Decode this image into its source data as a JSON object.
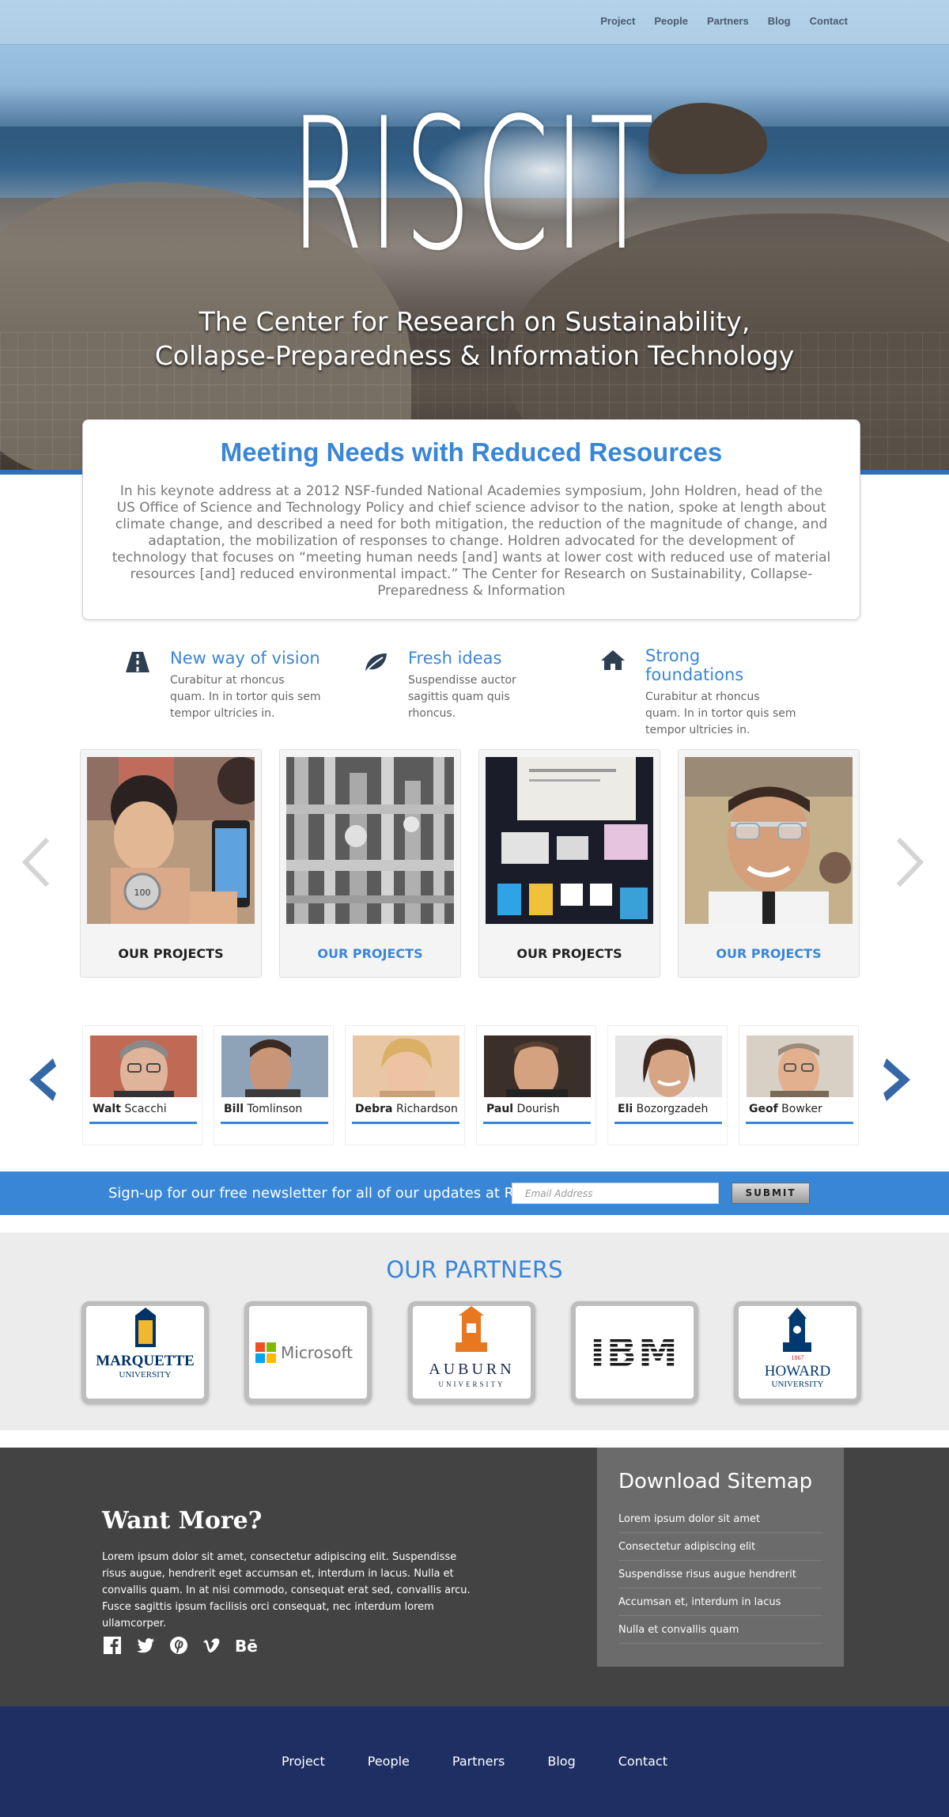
{
  "nav": {
    "items": [
      "Project",
      "People",
      "Partners",
      "Blog",
      "Contact"
    ]
  },
  "hero": {
    "logo": "RISCIT",
    "tagline_line1": "The Center for Research on Sustainability,",
    "tagline_line2": "Collapse-Preparedness & Information Technology"
  },
  "intro": {
    "title": "Meeting Needs with Reduced Resources",
    "body": "In his keynote address at a 2012 NSF-funded National Academies symposium, John Holdren, head of the US Office of Science and Technology Policy and chief science advisor to the nation, spoke at length about climate change, and described a need for both mitigation, the reduction of the magnitude of change, and adaptation, the mobilization of responses to change. Holdren advocated for the development of technology that focuses on “meeting human needs [and] wants at lower cost with reduced use of material resources [and] reduced environmental impact.” The Center for Research on Sustainability, Collapse-Preparedness & Information"
  },
  "features": [
    {
      "icon": "road-icon",
      "title": "New way of vision",
      "text": "Curabitur at rhoncus quam. In in tortor quis sem tempor ultricies in."
    },
    {
      "icon": "leaf-icon",
      "title": "Fresh ideas",
      "text": "Suspendisse auctor sagittis quam quis rhoncus."
    },
    {
      "icon": "home-icon",
      "title": "Strong foundations",
      "text": "Curabitur at rhoncus quam. In in tortor quis sem tempor ultricies in."
    }
  ],
  "projects": [
    {
      "caption": "OUR PROJECTS",
      "style": "dark"
    },
    {
      "caption": "OUR PROJECTS",
      "style": "blue"
    },
    {
      "caption": "OUR PROJECTS",
      "style": "dark"
    },
    {
      "caption": "OUR PROJECTS",
      "style": "blue"
    }
  ],
  "people": [
    {
      "first": "Walt",
      "last": " Scacchi"
    },
    {
      "first": "Bill",
      "last": " Tomlinson"
    },
    {
      "first": "Debra",
      "last": " Richardson"
    },
    {
      "first": "Paul",
      "last": " Dourish"
    },
    {
      "first": "Eli",
      "last": " Bozorgzadeh"
    },
    {
      "first": "Geof",
      "last": " Bowker"
    }
  ],
  "newsletter": {
    "label": "Sign-up for our free newsletter for all of our updates at RISCIT",
    "placeholder": "Email Address",
    "submit": "SUBMIT"
  },
  "partners": {
    "title": "OUR PARTNERS",
    "logos": {
      "marquette_1": "MARQUETTE",
      "marquette_2": "UNIVERSITY",
      "microsoft": "Microsoft",
      "auburn_1": "AUBURN",
      "auburn_2": "UNIVERSITY",
      "ibm": "IBM",
      "howard_year": "1867",
      "howard_1": "HOWARD",
      "howard_2": "UNIVERSITY"
    }
  },
  "more": {
    "title": "Want More?",
    "body": "Lorem ipsum dolor sit amet, consectetur adipiscing elit. Suspendisse risus augue, hendrerit eget accumsan et, interdum in lacus. Nulla et convallis quam. In at nisi commodo, consequat erat sed, convallis arcu. Fusce sagittis ipsum facilisis orci consequat, nec interdum lorem ullamcorper.",
    "social": [
      "facebook-icon",
      "twitter-icon",
      "pinterest-icon",
      "vimeo-icon",
      "behance-icon"
    ],
    "behance_text": "Bē"
  },
  "sitemap": {
    "title": "Download Sitemap",
    "items": [
      "Lorem ipsum dolor sit amet",
      "Consectetur adipiscing elit",
      "Suspendisse risus augue hendrerit",
      "Accumsan et, interdum in lacus",
      "Nulla et convallis quam"
    ]
  },
  "footer": {
    "items": [
      "Project",
      "People",
      "Partners",
      "Blog",
      "Contact"
    ]
  },
  "colors": {
    "accent": "#3a86d6",
    "footer": "#1f2f63",
    "dark_section": "#434343"
  }
}
